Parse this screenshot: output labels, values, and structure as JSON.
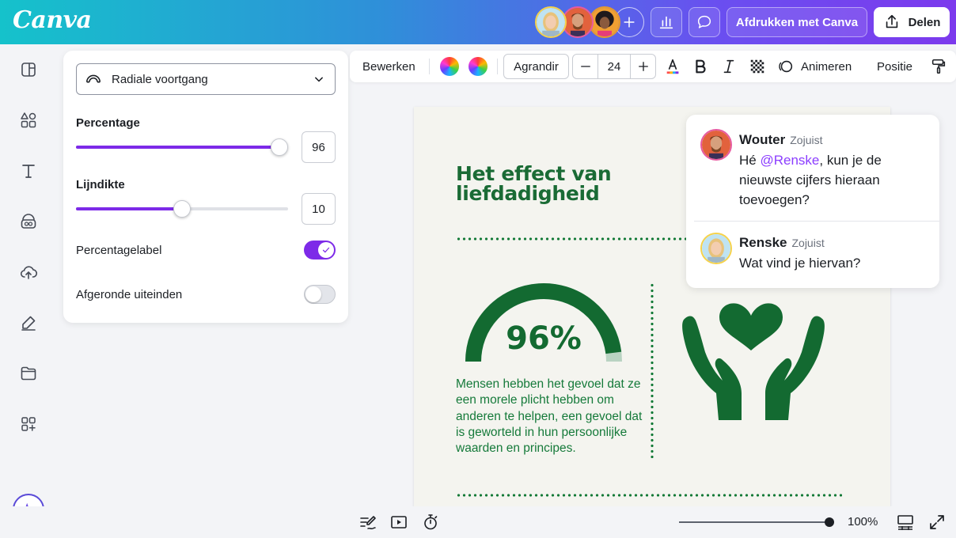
{
  "header": {
    "logo": "Canva",
    "print_label": "Afdrukken met Canva",
    "share_label": "Delen"
  },
  "panel": {
    "chart_type": "Radiale voortgang",
    "percentage_label": "Percentage",
    "percentage_value": "96",
    "percentage_fraction": 0.96,
    "line_label": "Lijndikte",
    "line_value": "10",
    "line_fraction": 0.5,
    "pct_label_toggle": "Percentagelabel",
    "pct_label_on": true,
    "rounded_ends_toggle": "Afgeronde uiteinden",
    "rounded_ends_on": false
  },
  "toolbar": {
    "edit_label": "Bewerken",
    "font_name": "Agrandir",
    "font_size": "24",
    "animate_label": "Animeren",
    "position_label": "Positie"
  },
  "canvas": {
    "title": "Het effect van liefdadigheid",
    "gauge_text": "96%",
    "gauge_fraction": 0.96,
    "body": "Mensen hebben het gevoel dat ze een morele plicht hebben om anderen te helpen, een gevoel dat is geworteld in hun persoonlijke waarden en principes."
  },
  "comments": [
    {
      "name": "Wouter",
      "time": "Zojuist",
      "pre": "Hé ",
      "mention": "@Renske",
      "post": ", kun je de nieuwste cijfers hieraan toevoegen?"
    },
    {
      "name": "Renske",
      "time": "Zojuist",
      "text": "Wat vind je hiervan?"
    }
  ],
  "bottom": {
    "zoom": "100%"
  },
  "colors": {
    "accent": "#7d2ae8",
    "canvas_green": "#136a31",
    "page_bg": "#f4f4ef"
  }
}
